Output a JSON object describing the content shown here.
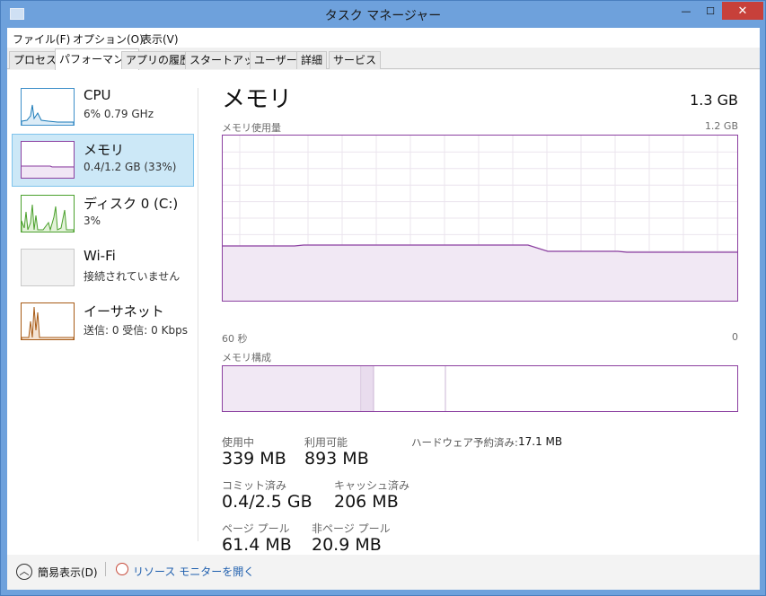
{
  "window": {
    "title": "タスク マネージャー",
    "controls": {
      "minimize": "—",
      "maximize": "☐",
      "close": "✕"
    }
  },
  "menu": [
    {
      "label": "ファイル(F)"
    },
    {
      "label": "オプション(O)"
    },
    {
      "label": "表示(V)"
    }
  ],
  "tabs": [
    {
      "label": "プロセス",
      "active": false
    },
    {
      "label": "パフォーマンス",
      "active": true
    },
    {
      "label": "アプリの履歴",
      "active": false
    },
    {
      "label": "スタートアップ",
      "active": false
    },
    {
      "label": "ユーザー",
      "active": false
    },
    {
      "label": "詳細",
      "active": false
    },
    {
      "label": "サービス",
      "active": false
    }
  ],
  "sidebar": {
    "items": [
      {
        "title": "CPU",
        "subtitle": "6% 0.79 GHz",
        "selected": false
      },
      {
        "title": "メモリ",
        "subtitle": "0.4/1.2 GB (33%)",
        "selected": true
      },
      {
        "title": "ディスク 0 (C:)",
        "subtitle": "3%",
        "selected": false
      },
      {
        "title": "Wi-Fi",
        "subtitle": "接続されていません",
        "selected": false
      },
      {
        "title": "イーサネット",
        "subtitle": "送信: 0 受信: 0 Kbps",
        "selected": false
      }
    ]
  },
  "main": {
    "title": "メモリ",
    "total": "1.3 GB",
    "usage_graph": {
      "label": "メモリ使用量",
      "max_label": "1.2 GB",
      "x_left": "60 秒",
      "x_right": "0"
    },
    "composition_label": "メモリ構成",
    "stats": {
      "in_use": {
        "label": "使用中",
        "value": "339 MB"
      },
      "available": {
        "label": "利用可能",
        "value": "893 MB"
      },
      "hardware_reserved": {
        "label": "ハードウェア予約済み:",
        "value": "17.1 MB"
      },
      "committed": {
        "label": "コミット済み",
        "value": "0.4/2.5 GB"
      },
      "cached": {
        "label": "キャッシュ済み",
        "value": "206 MB"
      },
      "paged_pool": {
        "label": "ページ プール",
        "value": "61.4 MB"
      },
      "nonpaged_pool": {
        "label": "非ページ プール",
        "value": "20.9 MB"
      }
    }
  },
  "footer": {
    "fewer_details": "簡易表示(D)",
    "resource_monitor": "リソース モニターを開く"
  },
  "colors": {
    "accent_purple": "#8b3fa0",
    "selection_bg": "#cce8f7",
    "cpu_line": "#1a7ab8",
    "disk_line": "#4aa02c",
    "ethernet_line": "#a75a15"
  }
}
